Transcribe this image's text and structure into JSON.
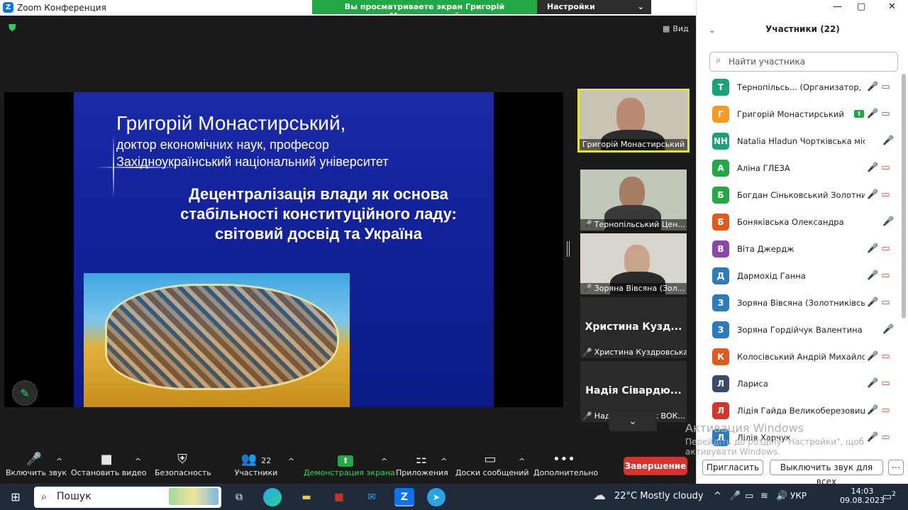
{
  "window": {
    "title": "Zoom Конференция",
    "banner_text": "Вы просматриваете экран Григорій Монастирський",
    "view_settings": "Настройки просмотра",
    "view_label": "Вид",
    "controls": [
      "—",
      "▢",
      "✕"
    ]
  },
  "slide": {
    "author": "Григорій Монастирський,",
    "degree": "доктор економічних наук, професор",
    "university": "Західноукраїнський національний університет",
    "title_lines": [
      "Децентралізація влади як основа",
      "стабільності конституційного ладу:",
      "світовий досвід та Україна"
    ]
  },
  "thumbnails": [
    {
      "label": "Григорій Монастирський",
      "type": "video"
    },
    {
      "label": "Тернопільський Цен...",
      "type": "video"
    },
    {
      "label": "Зоряна Вівсяна (Зол...",
      "type": "video"
    },
    {
      "big": "Христина  Кузд...",
      "label": "Христина Куздровська",
      "type": "name"
    },
    {
      "big": "Надія Сівардю...",
      "label": "Надія Сівардюк ВОК...",
      "type": "name"
    }
  ],
  "toolbar": {
    "items": [
      {
        "label": "Включить звук",
        "icon": "🎤"
      },
      {
        "label": "Остановить видео",
        "icon": "■"
      },
      {
        "label": "Безопасность",
        "icon": "⛨"
      },
      {
        "label": "Участники",
        "icon": "👥",
        "count": "22"
      },
      {
        "label": "Демонстрация экрана",
        "icon": "⬆"
      },
      {
        "label": "Приложения",
        "icon": "⚏"
      },
      {
        "label": "Доски сообщений",
        "icon": "▭"
      },
      {
        "label": "Дополнительно",
        "icon": "•••"
      }
    ],
    "end_label": "Завершение"
  },
  "panel": {
    "header": "Участники (22)",
    "search_placeholder": "Найти участника",
    "participants": [
      {
        "initials": "Т",
        "name": "Тернопільсь...  (Организатор, я)",
        "color": "#1aa37a",
        "icons": "mic-muted video"
      },
      {
        "initials": "Г",
        "name": "Григорій Монастирський",
        "color": "#f59a23",
        "icons": "share mic video"
      },
      {
        "initials": "NH",
        "name": "Natalia Hladun Чортківська міська ...",
        "color": "#1aa37a",
        "icons": "mic-muted"
      },
      {
        "initials": "А",
        "name": "Аліна ГЛЕЗА",
        "color": "#22a845",
        "icons": "mic-muted video-off"
      },
      {
        "initials": "Б",
        "name": "Богдан Сіньковський Золотни...",
        "color": "#22a845",
        "icons": "mic-muted video-off"
      },
      {
        "initials": "Б",
        "name": "Боняківська Олександра",
        "color": "#e05a1a",
        "icons": "mic-muted"
      },
      {
        "initials": "В",
        "name": "Віта Джердж",
        "color": "#8e44ad",
        "icons": "mic-muted video-off"
      },
      {
        "initials": "Д",
        "name": "Дармохід Ганна",
        "color": "#2b7bbd",
        "icons": "mic-muted video-off"
      },
      {
        "initials": "З",
        "name": "Зоряна Вівсяна (Золотниківсь...",
        "color": "#2b7bbd",
        "icons": "mic-muted video"
      },
      {
        "initials": "З",
        "name": "Зоряна Гордійчук Валентина Кури...",
        "color": "#2b7bbd",
        "icons": "mic-muted"
      },
      {
        "initials": "К",
        "name": "Колосівський Андрій Михайло...",
        "color": "#e05a1a",
        "icons": "mic-muted video-off"
      },
      {
        "initials": "Л",
        "name": "Лариса",
        "color": "#3a4a6b",
        "icons": "mic-muted video-off"
      },
      {
        "initials": "Л",
        "name": "Лідія Гайда Великоберезовиц...",
        "color": "#d4342c",
        "icons": "mic-muted video-off"
      },
      {
        "initials": "Л",
        "name": "Лілія Харчук",
        "color": "#2b7bbd",
        "icons": "mic-muted video-off"
      }
    ],
    "invite_label": "Пригласить",
    "mute_all_label": "Выключить звук для всех",
    "more_label": "⋯"
  },
  "watermark": {
    "title": "Активация Windows",
    "line1": "Перейдіть до розділу \"Настройки\", щоб",
    "line2": "активувати Windows."
  },
  "taskbar": {
    "search_text": "Пошук",
    "weather": "22°C  Mostly cloudy",
    "lang": "УКР",
    "time": "14:03",
    "date": "09.08.2023",
    "notif_count": "2"
  },
  "colors": {
    "accent_green": "#22a845",
    "muted_red": "#e0453d",
    "end_red": "#d4342c",
    "zoom_blue": "#0e72ed"
  }
}
